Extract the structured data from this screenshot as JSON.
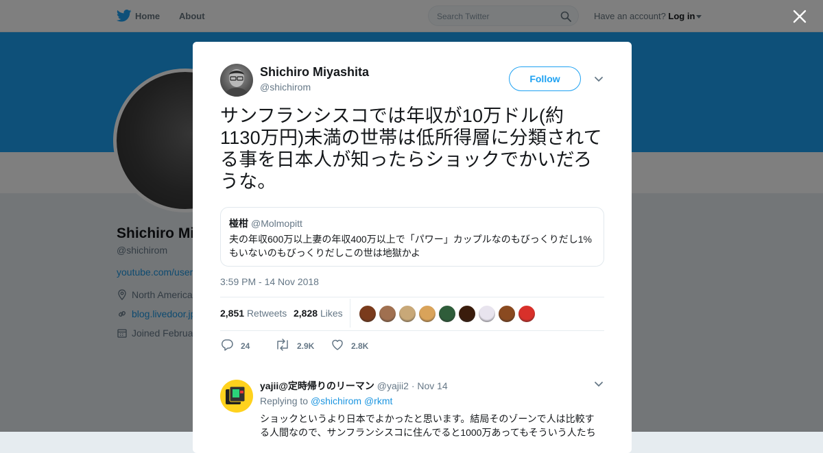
{
  "topbar": {
    "home_label": "Home",
    "about_label": "About",
    "search_placeholder": "Search Twitter",
    "account_prompt": "Have an account?",
    "login_label": "Log in"
  },
  "profile_bg": {
    "name": "Shichiro Mi",
    "handle": "@shichirom",
    "url": "youtube.com/user",
    "location": "North America",
    "website": "blog.livedoor.jp",
    "joined": "Joined Februa"
  },
  "tweet": {
    "author_name": "Shichiro Miyashita",
    "author_handle": "@shichirom",
    "follow_label": "Follow",
    "text": "サンフランシスコでは年収が10万ドル(約1130万円)未満の世帯は低所得層に分類されてる事を日本人が知ったらショックでかいだろうな。",
    "quoted": {
      "name": "椪柑",
      "handle": "@Molmopitt",
      "text": "夫の年収600万以上妻の年収400万以上で「パワー」カップルなのもびっくりだし1%もいないのもびっくりだしこの世は地獄かよ"
    },
    "timestamp": "3:59 PM - 14 Nov 2018",
    "retweets_count": "2,851",
    "retweets_label": "Retweets",
    "likes_count": "2,828",
    "likes_label": "Likes",
    "actions": {
      "reply_count": "24",
      "retweet_count": "2.9K",
      "like_count": "2.8K"
    }
  },
  "reply": {
    "name": "yajii@定時帰りのリーマン",
    "handle": "@yajii2",
    "date": "· Nov 14",
    "replying_prefix": "Replying to",
    "mention_1": "@shichirom",
    "mention_2": "@rkmt",
    "text": "ショックというより日本でよかったと思います。結局そのゾーンで人は比較する人間なので、サンフランシスコに住んでると1000万あってもそういう人たち"
  },
  "colors": {
    "brand": "#1da1f2",
    "link": "#1b95e0",
    "secondary_text": "#657786",
    "liker_avatars": [
      "#7a3b1c",
      "#a07050",
      "#c8a878",
      "#d9a35a",
      "#2f5d3a",
      "#3a1c0c",
      "#e8e4ee",
      "#8a4a20",
      "#d8302a"
    ]
  }
}
